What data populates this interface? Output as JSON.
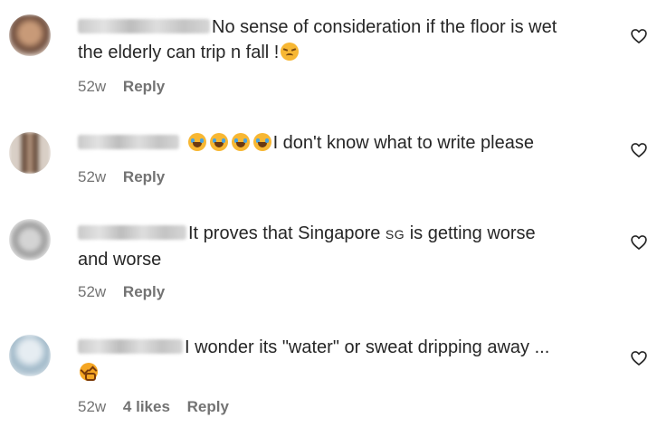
{
  "comments": [
    {
      "text_after_name": "No sense of consideration if the floor is wet",
      "text_line2": "the elderly can trip n fall !",
      "age": "52w",
      "reply_label": "Reply"
    },
    {
      "text_after_name": "I don't know what to write please",
      "age": "52w",
      "reply_label": "Reply"
    },
    {
      "text_after_name_1": "It proves that Singapore",
      "flag_text": "SG",
      "text_after_name_2": "is getting worse",
      "text_line2": "and worse",
      "age": "52w",
      "reply_label": "Reply"
    },
    {
      "text_after_name": "I wonder its \"water\" or sweat dripping away ...",
      "age": "52w",
      "likes": "4 likes",
      "reply_label": "Reply"
    }
  ],
  "icons": {
    "like": "heart-outline-icon",
    "emoji_sad": "pensive-face",
    "emoji_laugh": "tears-of-joy-face",
    "emoji_tired": "tired-face"
  },
  "colors": {
    "text": "#262626",
    "meta": "#737373",
    "background": "#ffffff"
  }
}
